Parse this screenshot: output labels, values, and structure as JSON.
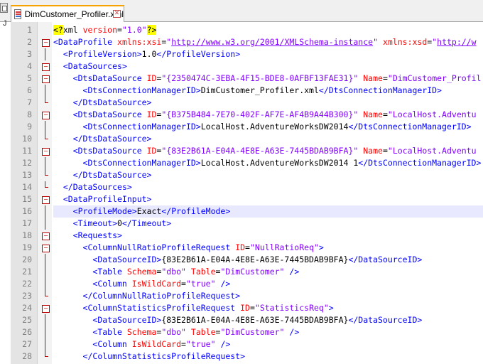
{
  "tab": {
    "title": "DimCustomer_Profiler.xml",
    "close_glyph": "✕"
  },
  "side": {
    "letter": "J"
  },
  "colors": {
    "tag": "#0000ff",
    "attr": "#ff0000",
    "value": "#8000ff",
    "text": "#000000",
    "fold": "#c00000",
    "current_line": "#e8e8ff"
  },
  "lines": [
    {
      "num": "1",
      "fold": "none",
      "indent": 0,
      "parts": [
        [
          "decl",
          "<?"
        ],
        [
          "txt",
          "xml "
        ],
        [
          "attr",
          "version"
        ],
        [
          "txt",
          "="
        ],
        [
          "val",
          "\"1.0\""
        ],
        [
          "decl",
          "?>"
        ]
      ]
    },
    {
      "num": "2",
      "fold": "box",
      "indent": 0,
      "parts": [
        [
          "tag",
          "<DataProfile "
        ],
        [
          "attr",
          "xmlns:xsi"
        ],
        [
          "txt",
          "="
        ],
        [
          "val",
          "\""
        ],
        [
          "url",
          "http://www.w3.org/2001/XMLSchema-instance"
        ],
        [
          "val",
          "\""
        ],
        [
          "txt",
          " "
        ],
        [
          "attr",
          "xmlns:xsd"
        ],
        [
          "txt",
          "="
        ],
        [
          "val",
          "\""
        ],
        [
          "url",
          "http://w"
        ]
      ]
    },
    {
      "num": "3",
      "fold": "vline",
      "indent": 1,
      "parts": [
        [
          "tag",
          "<ProfileVersion>"
        ],
        [
          "txt",
          "1.0"
        ],
        [
          "tag",
          "</ProfileVersion>"
        ]
      ]
    },
    {
      "num": "4",
      "fold": "box",
      "indent": 1,
      "parts": [
        [
          "tag",
          "<DataSources>"
        ]
      ]
    },
    {
      "num": "5",
      "fold": "box",
      "indent": 2,
      "parts": [
        [
          "tag",
          "<DtsDataSource "
        ],
        [
          "attr",
          "ID"
        ],
        [
          "txt",
          "="
        ],
        [
          "val",
          "\"{2350474C-3EBA-4F15-BDE8-0AFBF13FAE31}\""
        ],
        [
          "txt",
          " "
        ],
        [
          "attr",
          "Name"
        ],
        [
          "txt",
          "="
        ],
        [
          "val",
          "\"DimCustomer_Profil"
        ]
      ]
    },
    {
      "num": "6",
      "fold": "vline",
      "indent": 3,
      "parts": [
        [
          "tag",
          "<DtsConnectionManagerID>"
        ],
        [
          "txt",
          "DimCustomer_Profiler.xml"
        ],
        [
          "tag",
          "</DtsConnectionManagerID>"
        ]
      ]
    },
    {
      "num": "7",
      "fold": "end",
      "indent": 2,
      "parts": [
        [
          "tag",
          "</DtsDataSource>"
        ]
      ]
    },
    {
      "num": "8",
      "fold": "box",
      "indent": 2,
      "parts": [
        [
          "tag",
          "<DtsDataSource "
        ],
        [
          "attr",
          "ID"
        ],
        [
          "txt",
          "="
        ],
        [
          "val",
          "\"{B375B484-7E70-402F-AF7E-AF4B9A44B300}\""
        ],
        [
          "txt",
          " "
        ],
        [
          "attr",
          "Name"
        ],
        [
          "txt",
          "="
        ],
        [
          "val",
          "\"LocalHost.Adventu"
        ]
      ]
    },
    {
      "num": "9",
      "fold": "vline",
      "indent": 3,
      "parts": [
        [
          "tag",
          "<DtsConnectionManagerID>"
        ],
        [
          "txt",
          "LocalHost.AdventureWorksDW2014"
        ],
        [
          "tag",
          "</DtsConnectionManagerID>"
        ]
      ]
    },
    {
      "num": "10",
      "fold": "end",
      "indent": 2,
      "parts": [
        [
          "tag",
          "</DtsDataSource>"
        ]
      ]
    },
    {
      "num": "11",
      "fold": "box",
      "indent": 2,
      "parts": [
        [
          "tag",
          "<DtsDataSource "
        ],
        [
          "attr",
          "ID"
        ],
        [
          "txt",
          "="
        ],
        [
          "val",
          "\"{83E2B61A-E04A-4E8E-A63E-7445BDAB9BFA}\""
        ],
        [
          "txt",
          " "
        ],
        [
          "attr",
          "Name"
        ],
        [
          "txt",
          "="
        ],
        [
          "val",
          "\"LocalHost.Adventu"
        ]
      ]
    },
    {
      "num": "12",
      "fold": "vline",
      "indent": 3,
      "parts": [
        [
          "tag",
          "<DtsConnectionManagerID>"
        ],
        [
          "txt",
          "LocalHost.AdventureWorksDW2014 1"
        ],
        [
          "tag",
          "</DtsConnectionManagerID>"
        ]
      ]
    },
    {
      "num": "13",
      "fold": "end",
      "indent": 2,
      "parts": [
        [
          "tag",
          "</DtsDataSource>"
        ]
      ]
    },
    {
      "num": "14",
      "fold": "end",
      "indent": 1,
      "parts": [
        [
          "tag",
          "</DataSources>"
        ]
      ]
    },
    {
      "num": "15",
      "fold": "box",
      "indent": 1,
      "parts": [
        [
          "tag",
          "<DataProfileInput>"
        ]
      ]
    },
    {
      "num": "16",
      "fold": "vline",
      "indent": 2,
      "current": true,
      "parts": [
        [
          "tag",
          "<ProfileMode>"
        ],
        [
          "txt",
          "Exact"
        ],
        [
          "tag",
          "</ProfileMode>"
        ]
      ]
    },
    {
      "num": "17",
      "fold": "vline",
      "indent": 2,
      "parts": [
        [
          "tag",
          "<Timeout>"
        ],
        [
          "txt",
          "0"
        ],
        [
          "tag",
          "</Timeout>"
        ]
      ]
    },
    {
      "num": "18",
      "fold": "box",
      "indent": 2,
      "parts": [
        [
          "tag",
          "<Requests>"
        ]
      ]
    },
    {
      "num": "19",
      "fold": "box",
      "indent": 3,
      "parts": [
        [
          "tag",
          "<ColumnNullRatioProfileRequest "
        ],
        [
          "attr",
          "ID"
        ],
        [
          "txt",
          "="
        ],
        [
          "val",
          "\"NullRatioReq\""
        ],
        [
          "tag",
          ">"
        ]
      ]
    },
    {
      "num": "20",
      "fold": "vline",
      "indent": 4,
      "parts": [
        [
          "tag",
          "<DataSourceID>"
        ],
        [
          "txt",
          "{83E2B61A-E04A-4E8E-A63E-7445BDAB9BFA}"
        ],
        [
          "tag",
          "</DataSourceID>"
        ]
      ]
    },
    {
      "num": "21",
      "fold": "vline",
      "indent": 4,
      "parts": [
        [
          "tag",
          "<Table "
        ],
        [
          "attr",
          "Schema"
        ],
        [
          "txt",
          "="
        ],
        [
          "val",
          "\"dbo\""
        ],
        [
          "txt",
          " "
        ],
        [
          "attr",
          "Table"
        ],
        [
          "txt",
          "="
        ],
        [
          "val",
          "\"DimCustomer\""
        ],
        [
          "tag",
          " />"
        ]
      ]
    },
    {
      "num": "22",
      "fold": "vline",
      "indent": 4,
      "parts": [
        [
          "tag",
          "<Column "
        ],
        [
          "attr",
          "IsWildCard"
        ],
        [
          "txt",
          "="
        ],
        [
          "val",
          "\"true\""
        ],
        [
          "tag",
          " />"
        ]
      ]
    },
    {
      "num": "23",
      "fold": "end",
      "indent": 3,
      "parts": [
        [
          "tag",
          "</ColumnNullRatioProfileRequest>"
        ]
      ]
    },
    {
      "num": "24",
      "fold": "box",
      "indent": 3,
      "parts": [
        [
          "tag",
          "<ColumnStatisticsProfileRequest "
        ],
        [
          "attr",
          "ID"
        ],
        [
          "txt",
          "="
        ],
        [
          "val",
          "\"StatisticsReq\""
        ],
        [
          "tag",
          ">"
        ]
      ]
    },
    {
      "num": "25",
      "fold": "vline",
      "indent": 4,
      "parts": [
        [
          "tag",
          "<DataSourceID>"
        ],
        [
          "txt",
          "{83E2B61A-E04A-4E8E-A63E-7445BDAB9BFA}"
        ],
        [
          "tag",
          "</DataSourceID>"
        ]
      ]
    },
    {
      "num": "26",
      "fold": "vline",
      "indent": 4,
      "parts": [
        [
          "tag",
          "<Table "
        ],
        [
          "attr",
          "Schema"
        ],
        [
          "txt",
          "="
        ],
        [
          "val",
          "\"dbo\""
        ],
        [
          "txt",
          " "
        ],
        [
          "attr",
          "Table"
        ],
        [
          "txt",
          "="
        ],
        [
          "val",
          "\"DimCustomer\""
        ],
        [
          "tag",
          " />"
        ]
      ]
    },
    {
      "num": "27",
      "fold": "vline",
      "indent": 4,
      "parts": [
        [
          "tag",
          "<Column "
        ],
        [
          "attr",
          "IsWildCard"
        ],
        [
          "txt",
          "="
        ],
        [
          "val",
          "\"true\""
        ],
        [
          "tag",
          " />"
        ]
      ]
    },
    {
      "num": "28",
      "fold": "end",
      "indent": 3,
      "parts": [
        [
          "tag",
          "</ColumnStatisticsProfileRequest>"
        ]
      ]
    }
  ]
}
